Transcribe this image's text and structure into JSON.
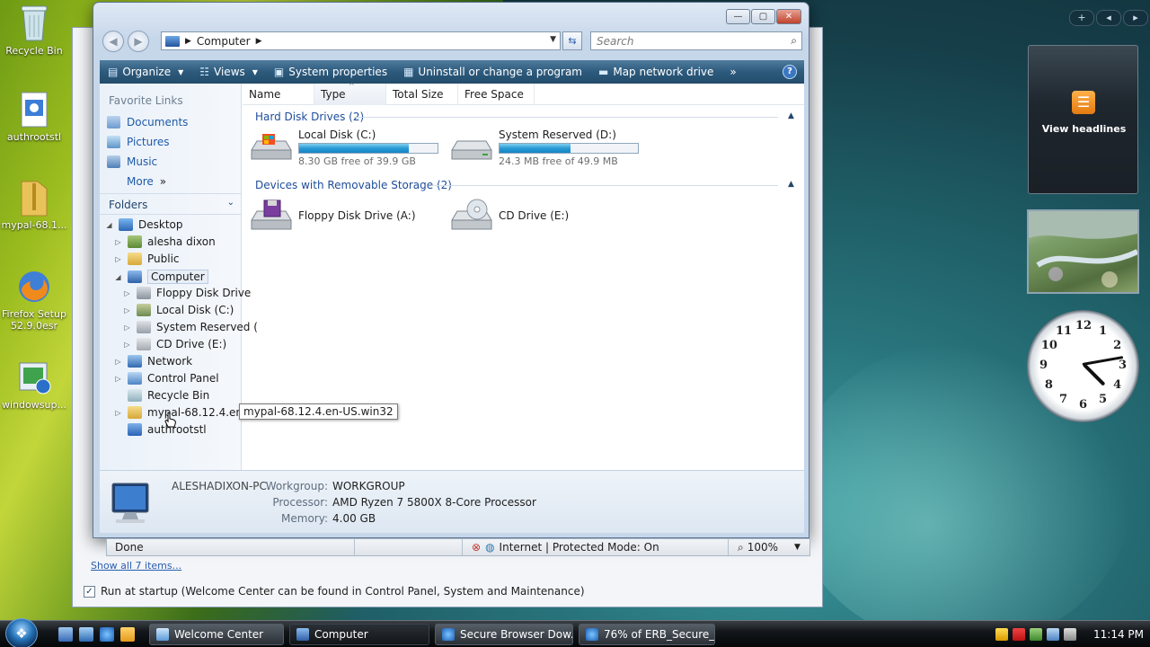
{
  "desktop": {
    "icons": [
      {
        "label": "Recycle Bin",
        "icon": "recycle-bin-icon"
      },
      {
        "label": "authrootstl",
        "icon": "installer-icon"
      },
      {
        "label": "mypal-68.1...",
        "icon": "zip-folder-icon"
      },
      {
        "label": "Firefox Setup 52.9.0esr",
        "icon": "firefox-icon"
      },
      {
        "label": "windowsup...",
        "icon": "windows-update-icon"
      }
    ]
  },
  "welcome_window": {
    "show_all": "Show all 7 items...",
    "run_at_startup": "Run at startup (Welcome Center can be found in Control Panel, System and Maintenance)"
  },
  "explorer": {
    "caption": {
      "minimize": "—",
      "maximize": "▢",
      "close": "✕"
    },
    "address": {
      "path": "Computer",
      "search_placeholder": "Search"
    },
    "toolbar": {
      "organize": "Organize",
      "views": "Views",
      "system_properties": "System properties",
      "uninstall": "Uninstall or change a program",
      "map_drive": "Map network drive",
      "more": "»",
      "help": "?"
    },
    "nav": {
      "favorite_links_title": "Favorite Links",
      "favorites": [
        "Documents",
        "Pictures",
        "Music"
      ],
      "more": "More",
      "more_chev": "»",
      "folders_title": "Folders",
      "tree": {
        "desktop": "Desktop",
        "user": "alesha dixon",
        "public": "Public",
        "computer": "Computer",
        "floppy": "Floppy Disk Drive",
        "local_c": "Local Disk (C:)",
        "system_reserved": "System Reserved (",
        "cd": "CD Drive (E:)",
        "network": "Network",
        "control_panel": "Control Panel",
        "recycle_bin": "Recycle Bin",
        "mypal": "mypal-68.12.4.en-US.win32",
        "authroot": "authrootstl"
      },
      "tooltip": "mypal-68.12.4.en-US.win32"
    },
    "columns": [
      "Name",
      "Type",
      "Total Size",
      "Free Space"
    ],
    "groups": {
      "hard_disks": "Hard Disk Drives (2)",
      "removable": "Devices with Removable Storage (2)"
    },
    "drives": {
      "c": {
        "name": "Local Disk (C:)",
        "free": "8.30 GB free of 39.9 GB",
        "used_fraction": 0.79
      },
      "d": {
        "name": "System Reserved (D:)",
        "free": "24.3 MB free of 49.9 MB",
        "used_fraction": 0.51
      },
      "a": {
        "name": "Floppy Disk Drive (A:)"
      },
      "e": {
        "name": "CD Drive (E:)"
      }
    },
    "details": {
      "computer_name": "ALESHADIXON-PC",
      "workgroup_label": "Workgroup:",
      "workgroup": "WORKGROUP",
      "processor_label": "Processor:",
      "processor": "AMD Ryzen 7 5800X 8-Core Processor",
      "memory_label": "Memory:",
      "memory": "4.00 GB"
    }
  },
  "ie_status": {
    "done": "Done",
    "zone": "Internet | Protected Mode: On",
    "zoom": "100%"
  },
  "gadgets": {
    "sidebar_add": "+",
    "sidebar_prev": "◂",
    "sidebar_next": "▸",
    "feed_text": "View headlines",
    "clock_numbers": [
      "12",
      "1",
      "2",
      "3",
      "4",
      "5",
      "6",
      "7",
      "8",
      "9",
      "10",
      "11"
    ]
  },
  "taskbar": {
    "start": "❖",
    "tasks": [
      "Welcome Center",
      "Computer",
      "Secure Browser Dow...",
      "76% of ERB_Secure_..."
    ],
    "time": "11:14 PM"
  },
  "colors": {
    "toolbar": "#2d5a7c",
    "link": "#1e5aa8",
    "progress": "#2a9ad4"
  }
}
